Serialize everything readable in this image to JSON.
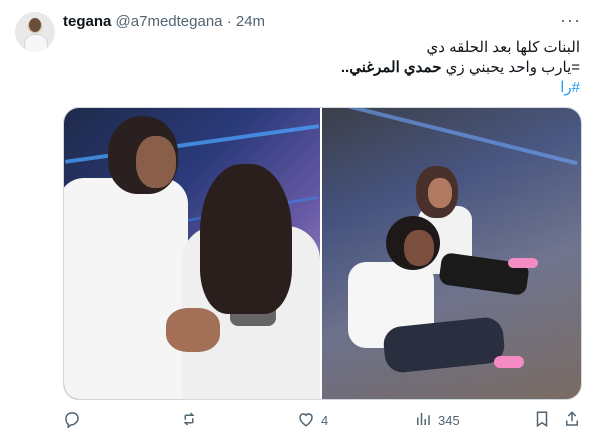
{
  "tweet": {
    "name": "tegana",
    "handle": "@a7medtegana",
    "separator": "·",
    "time": "24m",
    "more": "···",
    "text": {
      "line1": "البنات كلها بعد الحلقه دي",
      "line2_prefix": "=يارب واحد يحبني زي",
      "line2_bold": "حمدي المرغني..",
      "hashtag": "#را"
    },
    "counts": {
      "reply": "",
      "retweet": "",
      "likes": "4",
      "views": "345"
    }
  },
  "icons": {
    "reply": "reply-icon",
    "retweet": "retweet-icon",
    "like": "heart-icon",
    "views": "views-bar-chart-icon",
    "bookmark": "bookmark-icon",
    "share": "share-icon",
    "more": "more-horizontal-icon"
  },
  "colors": {
    "text": "#0f1419",
    "muted": "#536471",
    "link": "#1d9bf0",
    "border": "#cfd9de"
  }
}
